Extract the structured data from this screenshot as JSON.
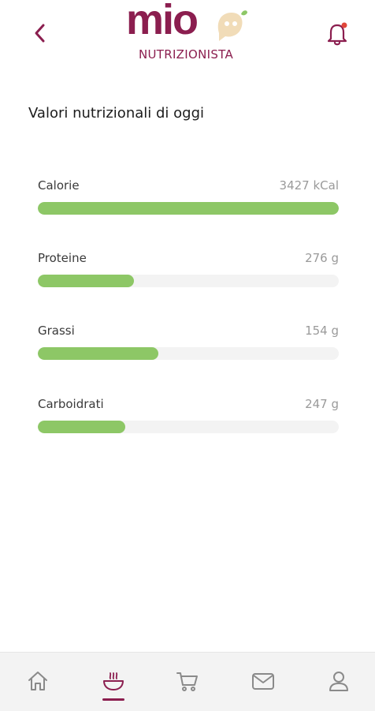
{
  "header": {
    "logo_word": "mio",
    "logo_subtitle": "NUTRIZIONISTA",
    "back_icon": "chevron-left-icon",
    "notification_icon": "bell-icon"
  },
  "section": {
    "title": "Valori nutrizionali di oggi"
  },
  "nutrients": [
    {
      "name": "Calorie",
      "value": "3427 kCal",
      "progress": 1.0
    },
    {
      "name": "Proteine",
      "value": "276 g",
      "progress": 0.32
    },
    {
      "name": "Grassi",
      "value": "154 g",
      "progress": 0.4
    },
    {
      "name": "Carboidrati",
      "value": "247 g",
      "progress": 0.29
    }
  ],
  "bottom_nav": {
    "items": [
      {
        "icon": "home-icon",
        "active": false
      },
      {
        "icon": "bowl-icon",
        "active": true
      },
      {
        "icon": "cart-icon",
        "active": false
      },
      {
        "icon": "mail-icon",
        "active": false
      },
      {
        "icon": "user-icon",
        "active": false
      }
    ]
  },
  "colors": {
    "brand": "#8b1e4f",
    "progress_fill": "#8dc766",
    "progress_track": "#f3f3f3",
    "mascot": "#f1dcb8",
    "notification_dot": "#e0463a"
  }
}
